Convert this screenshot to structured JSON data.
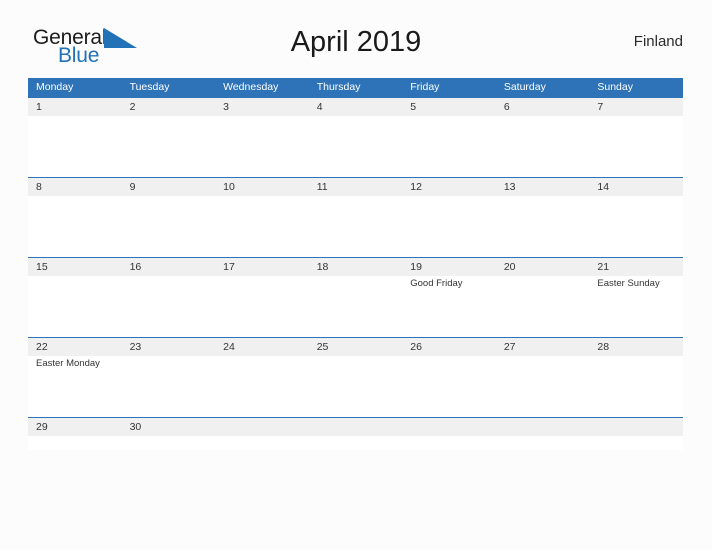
{
  "brand": {
    "name_top": "General",
    "name_bottom": "Blue",
    "flag_icon": "flag-triangle-icon",
    "color_top": "#1c1c1c",
    "color_bottom": "#2272b8",
    "flag_color": "#2272b8"
  },
  "header": {
    "title": "April 2019",
    "region": "Finland"
  },
  "theme": {
    "accent": "#2e72b8",
    "date_band": "#f0f0f0",
    "page_background": "#fcfcfc",
    "text": "#333333"
  },
  "calendar": {
    "weekdays": [
      "Monday",
      "Tuesday",
      "Wednesday",
      "Thursday",
      "Friday",
      "Saturday",
      "Sunday"
    ],
    "weeks": [
      {
        "days": [
          {
            "date": "1",
            "event": ""
          },
          {
            "date": "2",
            "event": ""
          },
          {
            "date": "3",
            "event": ""
          },
          {
            "date": "4",
            "event": ""
          },
          {
            "date": "5",
            "event": ""
          },
          {
            "date": "6",
            "event": ""
          },
          {
            "date": "7",
            "event": ""
          }
        ]
      },
      {
        "days": [
          {
            "date": "8",
            "event": ""
          },
          {
            "date": "9",
            "event": ""
          },
          {
            "date": "10",
            "event": ""
          },
          {
            "date": "11",
            "event": ""
          },
          {
            "date": "12",
            "event": ""
          },
          {
            "date": "13",
            "event": ""
          },
          {
            "date": "14",
            "event": ""
          }
        ]
      },
      {
        "days": [
          {
            "date": "15",
            "event": ""
          },
          {
            "date": "16",
            "event": ""
          },
          {
            "date": "17",
            "event": ""
          },
          {
            "date": "18",
            "event": ""
          },
          {
            "date": "19",
            "event": "Good Friday"
          },
          {
            "date": "20",
            "event": ""
          },
          {
            "date": "21",
            "event": "Easter Sunday"
          }
        ]
      },
      {
        "days": [
          {
            "date": "22",
            "event": "Easter Monday"
          },
          {
            "date": "23",
            "event": ""
          },
          {
            "date": "24",
            "event": ""
          },
          {
            "date": "25",
            "event": ""
          },
          {
            "date": "26",
            "event": ""
          },
          {
            "date": "27",
            "event": ""
          },
          {
            "date": "28",
            "event": ""
          }
        ]
      },
      {
        "days": [
          {
            "date": "29",
            "event": ""
          },
          {
            "date": "30",
            "event": ""
          },
          {
            "date": "",
            "event": ""
          },
          {
            "date": "",
            "event": ""
          },
          {
            "date": "",
            "event": ""
          },
          {
            "date": "",
            "event": ""
          },
          {
            "date": "",
            "event": ""
          }
        ]
      }
    ]
  }
}
